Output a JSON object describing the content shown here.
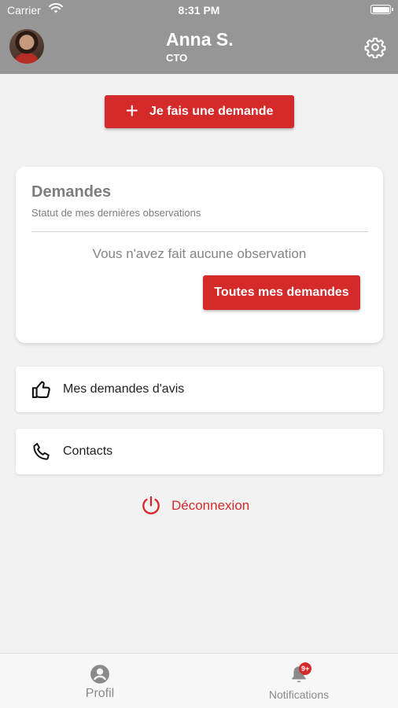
{
  "status_bar": {
    "carrier": "Carrier",
    "time": "8:31 PM"
  },
  "header": {
    "name": "Anna S.",
    "role": "CTO"
  },
  "actions": {
    "new_request_label": "Je fais une demande"
  },
  "requests_card": {
    "title": "Demandes",
    "subtitle": "Statut de mes dernières observations",
    "empty_message": "Vous n'avez fait aucune observation",
    "all_requests_label": "Toutes mes demandes"
  },
  "menu": {
    "opinion_requests_label": "Mes demandes d'avis",
    "contacts_label": "Contacts",
    "logout_label": "Déconnexion"
  },
  "bottom_nav": {
    "profile_label": "Profil",
    "notifications_label": "Notifications",
    "notifications_badge": "9+"
  },
  "colors": {
    "header": "#969696",
    "accent_red": "#d42a2a",
    "background": "#f2f2f2"
  },
  "icons": {
    "settings": "gear-icon",
    "new_request": "plus-icon",
    "opinion_requests": "thumbs-up-icon",
    "contacts": "phone-icon",
    "logout": "power-icon",
    "profile": "user-circle-icon",
    "notifications": "bell-icon"
  }
}
